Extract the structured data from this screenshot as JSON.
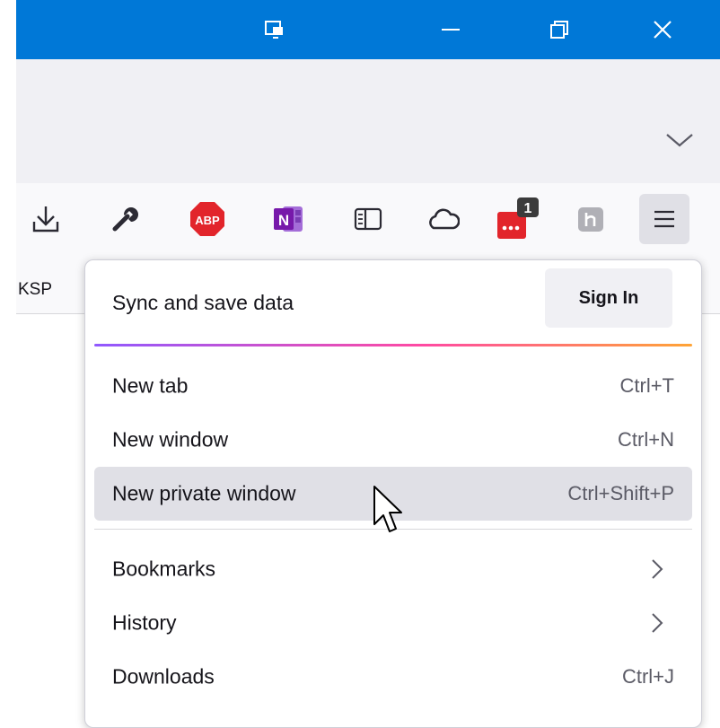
{
  "bookmarks_bar": {
    "item": "KSP"
  },
  "toolbar": {
    "abp_text": "ABP",
    "onenote_text": "N",
    "badge_count": "1"
  },
  "menu": {
    "sync": {
      "title": "Sync and save data",
      "signin_label": "Sign In"
    },
    "items": [
      {
        "label": "New tab",
        "shortcut": "Ctrl+T"
      },
      {
        "label": "New window",
        "shortcut": "Ctrl+N"
      },
      {
        "label": "New private window",
        "shortcut": "Ctrl+Shift+P",
        "state": "hover"
      },
      {
        "label": "Bookmarks",
        "submenu": true
      },
      {
        "label": "History",
        "submenu": true
      },
      {
        "label": "Downloads",
        "shortcut": "Ctrl+J"
      }
    ]
  },
  "colors": {
    "titlebar": "#0078d7",
    "abp_red": "#e2252b",
    "onenote_purple": "#7719aa",
    "hover": "#e0e0e6",
    "gradient": [
      "#9059ff",
      "#ff4aa2",
      "#ffa436"
    ]
  },
  "icons": [
    "picture-in-picture-icon",
    "minimize-icon",
    "restore-icon",
    "close-icon",
    "chevron-down-icon",
    "download-icon",
    "wrench-icon",
    "adblock-icon",
    "onenote-icon",
    "reader-view-icon",
    "cloud-icon",
    "extension-badge-icon",
    "grey-extension-icon",
    "hamburger-menu-icon",
    "chevron-right-icon",
    "mouse-cursor-icon"
  ]
}
